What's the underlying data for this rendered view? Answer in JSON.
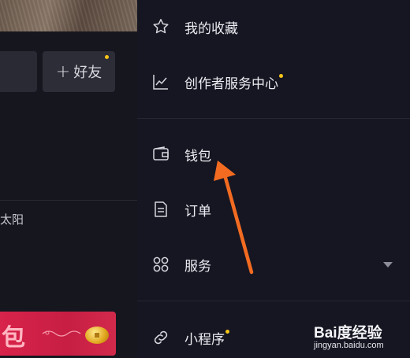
{
  "left_pane": {
    "add_friend_label": "好友",
    "sun_text": "太阳",
    "red_packet_text": "包"
  },
  "drawer": {
    "items": [
      {
        "label": "我的收藏",
        "icon": "star-icon"
      },
      {
        "label": "创作者服务中心",
        "icon": "chart-line-icon",
        "has_dot": true
      },
      {
        "label": "钱包",
        "icon": "wallet-icon"
      },
      {
        "label": "订单",
        "icon": "document-icon"
      },
      {
        "label": "服务",
        "icon": "grid-icon",
        "expandable": true
      },
      {
        "label": "小程序",
        "icon": "link-icon",
        "has_dot": true
      }
    ]
  },
  "watermark": {
    "logo_text": "Bai度经验",
    "url": "jingyan.baidu.com"
  },
  "colors": {
    "accent_dot": "#f5c518",
    "arrow": "#f26b21",
    "red_packet": "#d8234a",
    "background": "#161622"
  }
}
